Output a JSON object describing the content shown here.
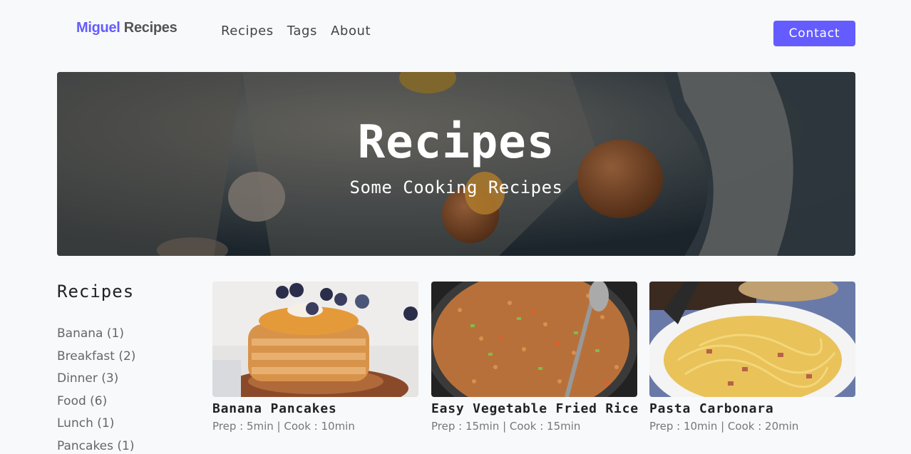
{
  "brand": {
    "first": "Miguel",
    "second": "Recipes"
  },
  "nav": {
    "links": [
      "Recipes",
      "Tags",
      "About"
    ],
    "contact_label": "Contact"
  },
  "hero": {
    "title": "Recipes",
    "subtitle": "Some Cooking Recipes"
  },
  "sidebar": {
    "title": "Recipes",
    "tags": [
      "Banana (1)",
      "Breakfast (2)",
      "Dinner (3)",
      "Food (6)",
      "Lunch (1)",
      "Pancakes (1)"
    ]
  },
  "recipes": [
    {
      "title": "Banana Pancakes",
      "meta": "Prep : 5min | Cook : 10min"
    },
    {
      "title": "Easy Vegetable Fried Rice",
      "meta": "Prep : 15min | Cook : 15min"
    },
    {
      "title": "Pasta Carbonara",
      "meta": "Prep : 10min | Cook : 20min"
    }
  ],
  "colors": {
    "accent": "#645cff",
    "background": "#f8f9fb"
  }
}
